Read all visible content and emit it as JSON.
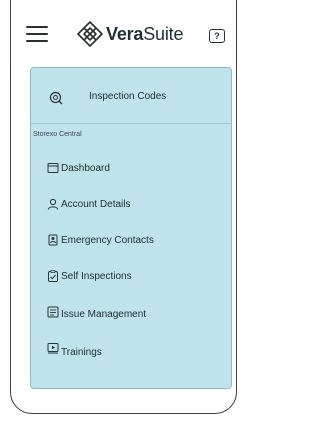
{
  "header": {
    "menu_icon": "hamburger-icon",
    "logo_icon": "diamond-lattice-logo",
    "logo_bold": "Vera",
    "logo_regular": "Suite",
    "help_label": "?"
  },
  "menu": {
    "inspection_codes": {
      "label": "Inspection Codes",
      "icon": "search-icon"
    },
    "section": "Storexo Central",
    "items": [
      {
        "label": "Dashboard",
        "icon": "window-icon"
      },
      {
        "label": "Account Details",
        "icon": "user-icon"
      },
      {
        "label": "Emergency Contacts",
        "icon": "contact-card-icon"
      },
      {
        "label": "Self Inspections",
        "icon": "clipboard-check-icon"
      },
      {
        "label": "Issue Management",
        "icon": "issue-list-icon"
      },
      {
        "label": "Trainings",
        "icon": "video-training-icon"
      }
    ]
  },
  "colors": {
    "menu_background": "#bfe3ea",
    "menu_border": "#8fbac4",
    "text": "#1f3035"
  }
}
